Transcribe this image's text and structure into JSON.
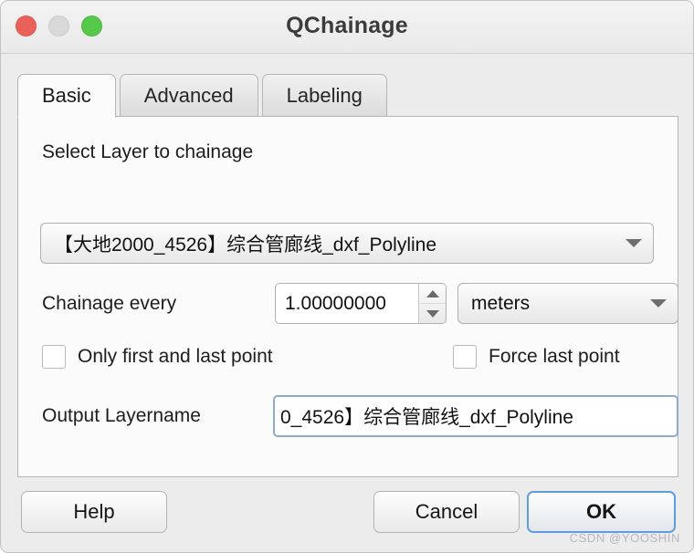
{
  "window": {
    "title": "QChainage",
    "traffic_lights": [
      {
        "name": "close-button",
        "color": "#e8615a"
      },
      {
        "name": "minimize-button",
        "color": "#d9d9d9"
      },
      {
        "name": "maximize-button",
        "color": "#56c84a"
      }
    ]
  },
  "tabs": [
    {
      "label": "Basic",
      "active": true
    },
    {
      "label": "Advanced",
      "active": false
    },
    {
      "label": "Labeling",
      "active": false
    }
  ],
  "basic": {
    "select_layer_label": "Select Layer to chainage",
    "layer_combo": {
      "value": "【大地2000_4526】综合管廊线_dxf_Polyline",
      "arrow_icon": "chevron-down-icon"
    },
    "chainage_label": "Chainage every",
    "chainage_value": "1.00000000",
    "spin_up_icon": "triangle-up-icon",
    "spin_down_icon": "triangle-down-icon",
    "units_combo": {
      "value": "meters",
      "arrow_icon": "chevron-down-icon"
    },
    "checkboxes": [
      {
        "label": "Only first and last point",
        "checked": false
      },
      {
        "label": "Force last point",
        "checked": false
      }
    ],
    "output_label": "Output Layername",
    "output_value": "0_4526】综合管廊线_dxf_Polyline",
    "output_focus_color": "#8cabcd"
  },
  "buttons": {
    "help": "Help",
    "cancel": "Cancel",
    "ok": "OK",
    "ok_focus_color": "#5c9de1"
  },
  "watermark": "CSDN @YOOSHIN"
}
